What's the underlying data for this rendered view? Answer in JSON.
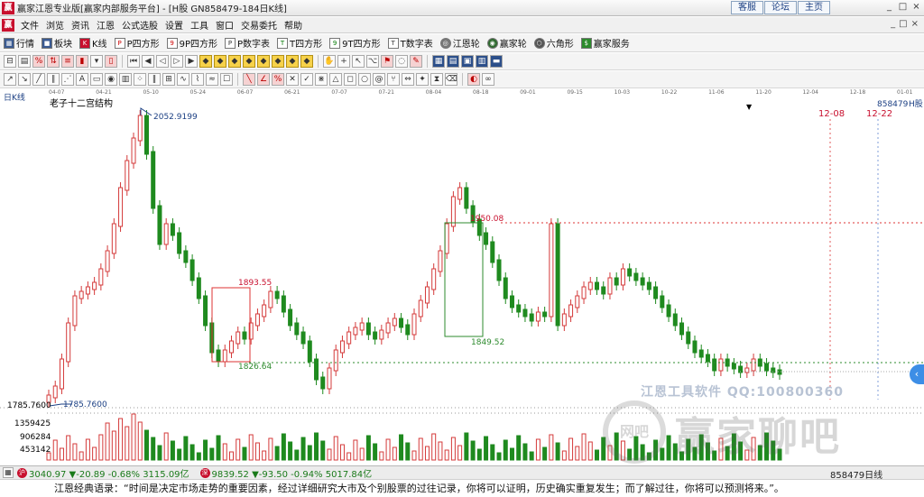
{
  "window": {
    "title": "赢家江恩专业版[赢家内部服务平台] - [H股  GN858479-184日K线]",
    "quicklinks": [
      "客服",
      "论坛",
      "主页"
    ],
    "controls": [
      "_",
      "□",
      "×"
    ]
  },
  "menu": {
    "items": [
      "文件",
      "浏览",
      "资讯",
      "江恩",
      "公式选股",
      "设置",
      "工具",
      "窗口",
      "交易委托",
      "帮助"
    ],
    "right_controls": [
      "_",
      "□",
      "×"
    ]
  },
  "toolbar1": {
    "items": [
      {
        "label": "行情",
        "icon": "grid-icon"
      },
      {
        "label": "板块",
        "icon": "blocks-icon"
      },
      {
        "label": "K线",
        "icon": "kline-icon"
      },
      {
        "label": "P四方形",
        "icon": "p-square-icon"
      },
      {
        "label": "9P四方形",
        "icon": "9p-square-icon"
      },
      {
        "label": "P数字表",
        "icon": "p-table-icon"
      },
      {
        "label": "T四方形",
        "icon": "t-square-icon"
      },
      {
        "label": "9T四方形",
        "icon": "9t-square-icon"
      },
      {
        "label": "T数字表",
        "icon": "t-table-icon"
      },
      {
        "label": "江恩轮",
        "icon": "wheel-icon"
      },
      {
        "label": "赢家轮",
        "icon": "winner-wheel-icon"
      },
      {
        "label": "六角形",
        "icon": "hexagon-icon"
      },
      {
        "label": "赢家服务",
        "icon": "service-icon"
      }
    ]
  },
  "chart": {
    "panel_label": "日K线",
    "indicator_label": "老子十二宫结构",
    "stock_label": "858479",
    "stock_type": "H股",
    "date_axis": [
      "04-07",
      "04-21",
      "05-10",
      "05-24",
      "06-07",
      "06-21",
      "07-07",
      "07-21",
      "08-04",
      "08-18",
      "09-01",
      "09-15",
      "10-03",
      "10-22",
      "11-06",
      "11-20",
      "12-04",
      "12-18",
      "01-01"
    ],
    "future_markers": [
      "12-08",
      "12-22"
    ],
    "y_left_labels": [
      "1785.7600"
    ],
    "volume_labels": [
      "1359425",
      "906284",
      "453142"
    ],
    "annotations": {
      "high": "2052.9199",
      "low": "1785.7600",
      "box1_high": "1893.55",
      "box1_low": "1826.64",
      "box2_high": "1950.08",
      "box2_low": "1849.52"
    },
    "watermark_line": "江恩工具软件  QQ:100800360",
    "watermark_circle": "网吧",
    "watermark_text": "赢家聊吧"
  },
  "chart_data": {
    "type": "candlestick",
    "title": "",
    "series": [
      {
        "name": "日K线",
        "range": [
          1785.76,
          2052.92
        ]
      }
    ],
    "volume_scale": [
      453142,
      906284,
      1359425
    ]
  },
  "status": {
    "idx1": {
      "icon": "沪",
      "text": "3040.97 ▼-20.89 -0.68% 3115.09亿"
    },
    "idx2": {
      "icon": "深",
      "text": "9839.52 ▼-93.50 -0.94% 5017.84亿"
    },
    "right": "858479日线"
  },
  "quote": "江恩经典语录：“时间是决定市场走势的重要因素，经过详细研究大市及个别股票的过往记录，你将可以证明，历史确实重复发生；而了解过往，你将可以预测将来。”。"
}
